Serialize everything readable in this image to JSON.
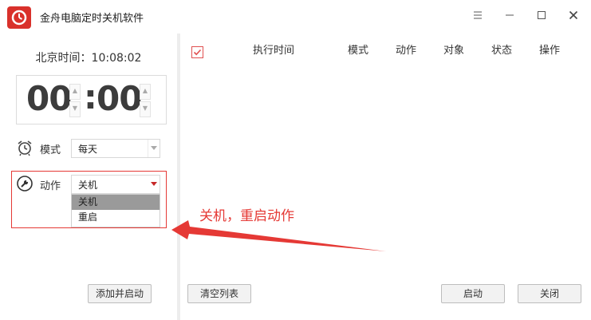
{
  "window": {
    "title": "金舟电脑定时关机软件"
  },
  "left": {
    "clock_label": "北京时间：10:08:02",
    "hours": "00",
    "minutes": "00",
    "colon": ":",
    "mode_label": "模式",
    "mode_value": "每天",
    "action_label": "动作",
    "action_value": "关机",
    "action_options": [
      "关机",
      "重启"
    ],
    "add_button": "添加并启动"
  },
  "table": {
    "headers": [
      "执行时间",
      "模式",
      "动作",
      "对象",
      "状态",
      "操作"
    ]
  },
  "right": {
    "clear_button": "清空列表",
    "start_button": "启动",
    "close_button": "关闭"
  },
  "annotation": {
    "text": "关机，重启动作",
    "color": "#e53935"
  },
  "colors": {
    "brand": "#d9312b",
    "highlight": "#e53935"
  }
}
